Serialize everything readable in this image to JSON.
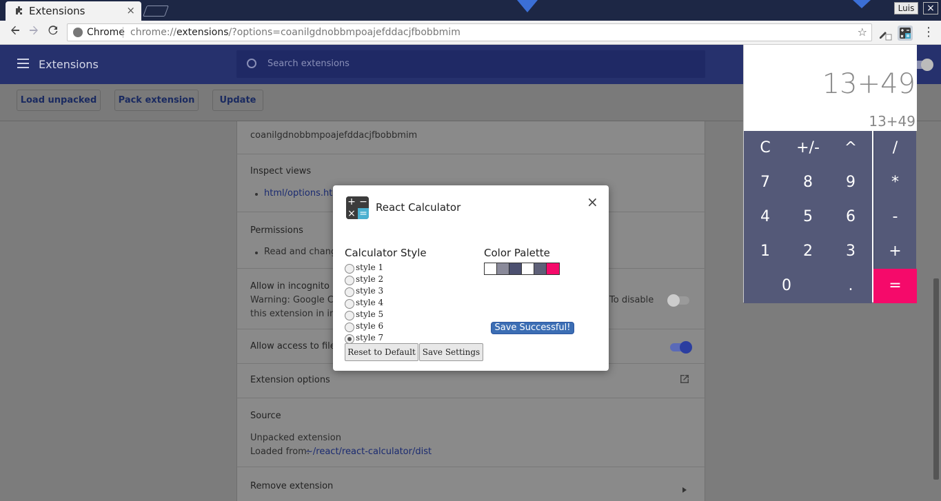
{
  "browser": {
    "tab_title": "Extensions",
    "tab_close": "×",
    "user_name": "Luis",
    "window_close": "×",
    "omnibox_origin": "Chrome",
    "url_prefix": "chrome://",
    "url_host": "extensions",
    "url_rest": "/?options=coanilgdnobbmpoajefddacjfbobbmim",
    "back_icon": "arrow-left",
    "forward_icon": "arrow-right",
    "reload_icon": "reload",
    "star_icon": "star",
    "menu_icon": "vertical-dots"
  },
  "extensions_page": {
    "title": "Extensions",
    "search_placeholder": "Search extensions",
    "buttons": {
      "load_unpacked": "Load unpacked",
      "pack_extension": "Pack extension",
      "update": "Update"
    },
    "details": {
      "id": "coanilgdnobbmpoajefddacjfbobbmim",
      "inspect_views_label": "Inspect views",
      "inspect_view_link": "html/options.html",
      "permissions_label": "Permissions",
      "permission_item": "Read and change",
      "incognito_label": "Allow in incognito",
      "incognito_warning_1": "Warning: Google Chrome",
      "incognito_warning_1b": "To disable",
      "incognito_warning_2": "this extension in incognito",
      "file_access_label": "Allow access to file URLs",
      "extension_options_label": "Extension options",
      "source_label": "Source",
      "source_type": "Unpacked extension",
      "loaded_from_label": "Loaded from:",
      "loaded_from_path": "~/react/react-calculator/dist",
      "remove_label": "Remove extension"
    }
  },
  "calculator": {
    "expression": "13+49",
    "result": "13+49",
    "keys": [
      [
        "C",
        "+/-",
        "^",
        "/"
      ],
      [
        "7",
        "8",
        "9",
        "*"
      ],
      [
        "4",
        "5",
        "6",
        "-"
      ],
      [
        "1",
        "2",
        "3",
        "+"
      ],
      [
        "0",
        ".",
        "="
      ]
    ]
  },
  "modal": {
    "app_name": "React Calculator",
    "close": "×",
    "calculator_style_heading": "Calculator Style",
    "color_palette_heading": "Color Palette",
    "styles": [
      "style 1",
      "style 2",
      "style 3",
      "style 4",
      "style 5",
      "style 6",
      "style 7"
    ],
    "selected_style": "style 7",
    "palette_colors": [
      "#ffffff",
      "#8a8a9a",
      "#4c5070",
      "#ffffff",
      "#5e6078",
      "#f50a6a"
    ],
    "reset_button": "Reset to Default",
    "save_button": "Save Settings",
    "save_status": "Save Successful!"
  },
  "colors": {
    "accent": "#3f51b5",
    "calc_key": "#545978",
    "calc_equals": "#f50a6a"
  }
}
